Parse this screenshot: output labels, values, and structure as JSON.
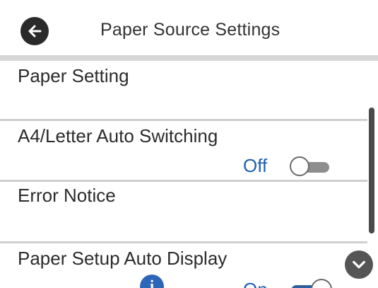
{
  "header": {
    "title": "Paper Source Settings",
    "back_icon": "arrow-left-icon"
  },
  "rows": [
    {
      "label": "Paper Setting"
    },
    {
      "label": "A4/Letter Auto Switching",
      "value": "Off",
      "toggle": "off"
    },
    {
      "label": "Error Notice"
    },
    {
      "label": "Paper Setup Auto Display",
      "value": "On",
      "toggle": "on",
      "info_icon": "info-icon"
    }
  ],
  "scroll_down_icon": "chevron-down-icon",
  "colors": {
    "value_text": "#1f5fb3",
    "toggle_on": "#2f5f9e",
    "toggle_off": "#8e8e8e",
    "divider": "#cfcfcf"
  }
}
